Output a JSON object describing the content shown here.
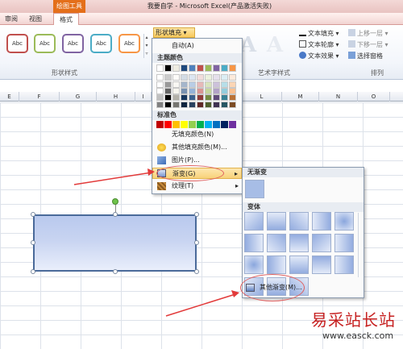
{
  "titlebar": {
    "context_tab": "绘图工具",
    "title": "我要自学 - Microsoft Excel(产品激活失败)"
  },
  "tabs": [
    {
      "label": "审阅"
    },
    {
      "label": "视图"
    },
    {
      "label": "格式"
    }
  ],
  "ribbon": {
    "shape_style_swatches": [
      "Abc",
      "Abc",
      "Abc",
      "Abc",
      "Abc"
    ],
    "swatch_colors": [
      "#c0504d",
      "#9bbb59",
      "#8064a2",
      "#4bacc6",
      "#f79646"
    ],
    "group_shape_styles": "形状样式",
    "group_wordart": "艺术字样式",
    "group_arrange": "排列",
    "shape_fill_button": "形状填充",
    "text_fill": "文本填充",
    "text_outline": "文本轮廓",
    "text_effect": "文本效果",
    "bring_forward": "上移一层",
    "send_backward": "下移一层",
    "selection_pane": "选择窗格",
    "wordart_letter": "A"
  },
  "columns": [
    "E",
    "F",
    "G",
    "H",
    "I",
    "L",
    "M",
    "N",
    "O"
  ],
  "fill_menu": {
    "auto": "自动(A)",
    "theme_colors_label": "主题颜色",
    "theme_top": [
      "#ffffff",
      "#000000",
      "#eeece1",
      "#1f497d",
      "#4f81bd",
      "#c0504d",
      "#9bbb59",
      "#8064a2",
      "#4bacc6",
      "#f79646"
    ],
    "standard_colors_label": "标准色",
    "standard_colors": [
      "#c00000",
      "#ff0000",
      "#ffc000",
      "#ffff00",
      "#92d050",
      "#00b050",
      "#00b0f0",
      "#0070c0",
      "#002060",
      "#7030a0"
    ],
    "no_fill": "无填充颜色(N)",
    "more_colors": "其他填充颜色(M)...",
    "picture": "图片(P)...",
    "gradient": "渐变(G)",
    "texture": "纹理(T)"
  },
  "gradient_submenu": {
    "no_gradient_label": "无渐变",
    "variants_label": "变体",
    "more_gradients": "其他渐变(M)..."
  },
  "watermark": {
    "site_name": "易采站长站",
    "url": "www.easck.com"
  }
}
